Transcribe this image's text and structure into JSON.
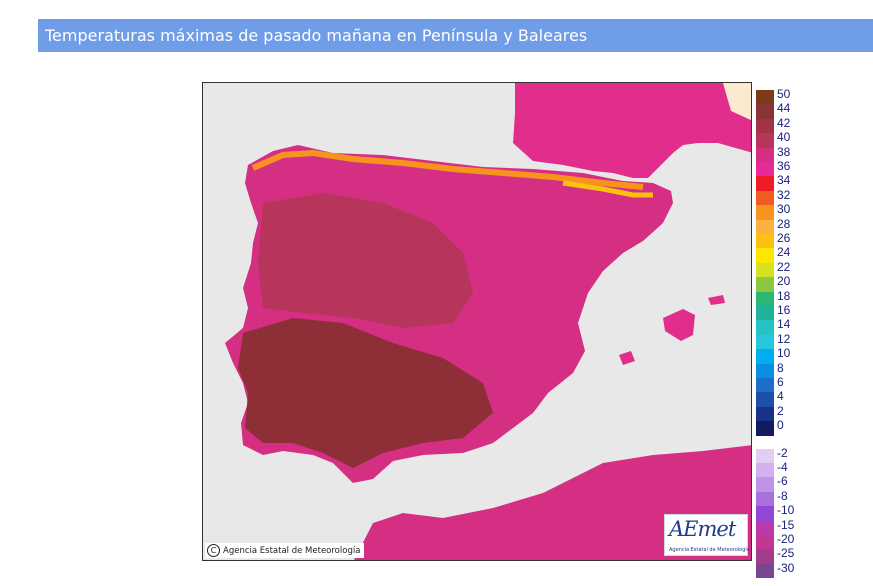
{
  "header": {
    "title": "Temperaturas máximas de pasado mañana en Península y Baleares"
  },
  "map": {
    "credit_text": "Agencia Estatal de Meteorología",
    "copyright_symbol": "C",
    "logo_text": "AEmet",
    "logo_subtitle": "Agencia Estatal de Meteorología",
    "colors": {
      "sea": "#e8e8e8",
      "france_north": "#f9ead0",
      "hot": "#8e2f37",
      "warm": "#c9314f",
      "mild": "#e12d8c"
    }
  },
  "legend": {
    "positive": [
      {
        "label": "50",
        "color": "#7a3b17"
      },
      {
        "label": "44",
        "color": "#8a3438"
      },
      {
        "label": "42",
        "color": "#a23246"
      },
      {
        "label": "40",
        "color": "#b7345a"
      },
      {
        "label": "38",
        "color": "#d52f84"
      },
      {
        "label": "36",
        "color": "#e8299a"
      },
      {
        "label": "34",
        "color": "#ee1c25"
      },
      {
        "label": "32",
        "color": "#f15a22"
      },
      {
        "label": "30",
        "color": "#f7941d"
      },
      {
        "label": "28",
        "color": "#fbb040"
      },
      {
        "label": "26",
        "color": "#fcc010"
      },
      {
        "label": "24",
        "color": "#ffe600"
      },
      {
        "label": "22",
        "color": "#d7e021"
      },
      {
        "label": "20",
        "color": "#8dc63f"
      },
      {
        "label": "18",
        "color": "#2bb673"
      },
      {
        "label": "16",
        "color": "#1fb39c"
      },
      {
        "label": "14",
        "color": "#25c4c4"
      },
      {
        "label": "12",
        "color": "#27c7dd"
      },
      {
        "label": "10",
        "color": "#00aeef"
      },
      {
        "label": "8",
        "color": "#0a8fe0"
      },
      {
        "label": "6",
        "color": "#1b6fc8"
      },
      {
        "label": "4",
        "color": "#1c4fa8"
      },
      {
        "label": "2",
        "color": "#1a3188"
      },
      {
        "label": "0",
        "color": "#141a5f"
      }
    ],
    "negative": [
      {
        "label": "-2",
        "color": "#e3cdf2"
      },
      {
        "label": "-4",
        "color": "#d3b0ee"
      },
      {
        "label": "-6",
        "color": "#bf93e8"
      },
      {
        "label": "-8",
        "color": "#a970e0"
      },
      {
        "label": "-10",
        "color": "#9347d6"
      },
      {
        "label": "-15",
        "color": "#b93aa8"
      },
      {
        "label": "-20",
        "color": "#c23796"
      },
      {
        "label": "-25",
        "color": "#a23d8e"
      },
      {
        "label": "-30",
        "color": "#7b4690"
      }
    ]
  }
}
